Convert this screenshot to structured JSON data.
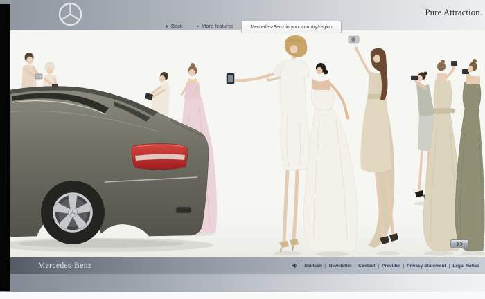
{
  "header": {
    "claim": "Pure Attraction."
  },
  "nav": {
    "back_label": "Back",
    "more_features_label": "More features",
    "country_tab_label": "Mercedes-Benz in your country/region"
  },
  "hero": {
    "description": "White studio photo: rear three-quarter view of an olive-grey Mercedes-Benz coupe at left, surrounded by nine fashion models in pink, white, champagne, beige and olive evening dresses photographing the car with compact cameras",
    "car_color": "#6e6e62",
    "taillight_color": "#b02a26"
  },
  "footer": {
    "wordmark": "Mercedes-Benz",
    "links": [
      {
        "label": "Deutsch"
      },
      {
        "label": "Newsletter"
      },
      {
        "label": "Contact"
      },
      {
        "label": "Provider"
      },
      {
        "label": "Privacy Statement"
      },
      {
        "label": "Legal Notice"
      }
    ]
  },
  "colors": {
    "header_gradient_start": "#8e959e",
    "header_gradient_end": "#edeff1",
    "brandbar_start": "#4f5660",
    "brandbar_end": "#c9ced5",
    "link_text": "#2a3a5e"
  }
}
